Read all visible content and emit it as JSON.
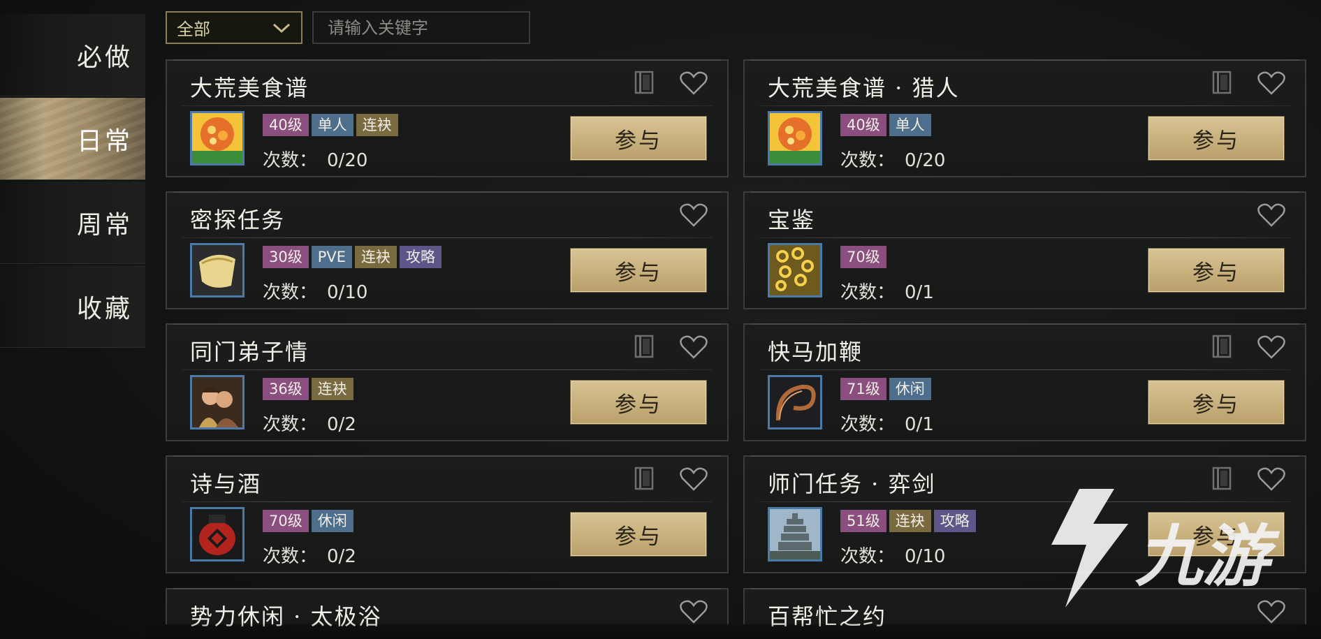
{
  "sidebar": {
    "items": [
      {
        "label": "必做",
        "active": false
      },
      {
        "label": "日常",
        "active": true
      },
      {
        "label": "周常",
        "active": false
      },
      {
        "label": "收藏",
        "active": false
      }
    ]
  },
  "filter": {
    "dropdown_value": "全部",
    "search_placeholder": "请输入关键字"
  },
  "join_label": "参与",
  "count_label": "次数：",
  "cards": [
    {
      "title": "大荒美食谱",
      "icon": "food-dish-icon",
      "tags": [
        "40级",
        "单人",
        "连袂"
      ],
      "count": "0/20",
      "has_book": true
    },
    {
      "title": "大荒美食谱 · 猎人",
      "icon": "food-dish-icon",
      "tags": [
        "40级",
        "单人"
      ],
      "count": "0/20",
      "has_book": true
    },
    {
      "title": "密探任务",
      "icon": "scroll-icon",
      "tags": [
        "30级",
        "PVE",
        "连袂",
        "攻略"
      ],
      "count": "0/10",
      "has_book": false
    },
    {
      "title": "宝鉴",
      "icon": "coins-icon",
      "tags": [
        "70级"
      ],
      "count": "0/1",
      "has_book": false
    },
    {
      "title": "同门弟子情",
      "icon": "couple-portrait-icon",
      "tags": [
        "36级",
        "连袂"
      ],
      "count": "0/2",
      "has_book": true
    },
    {
      "title": "快马加鞭",
      "icon": "whip-icon",
      "tags": [
        "71级",
        "休闲"
      ],
      "count": "0/1",
      "has_book": true
    },
    {
      "title": "诗与酒",
      "icon": "wine-jar-icon",
      "tags": [
        "70级",
        "休闲"
      ],
      "count": "0/2",
      "has_book": true
    },
    {
      "title": "师门任务 · 弈剑",
      "icon": "pagoda-icon",
      "tags": [
        "51级",
        "连袂",
        "攻略"
      ],
      "count": "0/10",
      "has_book": true
    },
    {
      "title": "势力休闲 · 太极浴",
      "icon": "",
      "tags": [],
      "count": "",
      "has_book": false
    },
    {
      "title": "百帮忙之约",
      "icon": "",
      "tags": [],
      "count": "",
      "has_book": false
    }
  ],
  "watermark": "九游",
  "colors": {
    "accent_gold": "#c9b27f",
    "tag_level": "#8a4f7e",
    "tag_blue": "#4d6f8c",
    "tag_gold": "#7a6a3f",
    "tag_purple": "#5e5688"
  }
}
